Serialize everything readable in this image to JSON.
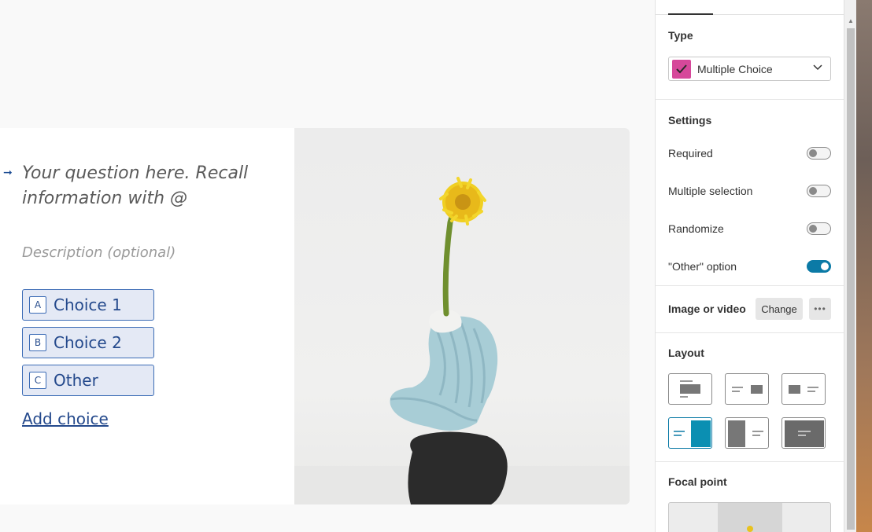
{
  "question": {
    "title": "Your question here. Recall information with @",
    "description": "Description (optional)",
    "choices": [
      {
        "key": "A",
        "label": "Choice 1"
      },
      {
        "key": "B",
        "label": "Choice 2"
      },
      {
        "key": "C",
        "label": "Other"
      }
    ],
    "add_choice": "Add choice"
  },
  "panel": {
    "type": {
      "heading": "Type",
      "value": "Multiple Choice",
      "color": "#d6489a"
    },
    "settings": {
      "heading": "Settings",
      "rows": [
        {
          "label": "Required",
          "on": false
        },
        {
          "label": "Multiple selection",
          "on": false
        },
        {
          "label": "Randomize",
          "on": false
        },
        {
          "label": "\"Other\" option",
          "on": true
        }
      ]
    },
    "media": {
      "heading": "Image or video",
      "change": "Change"
    },
    "layout": {
      "heading": "Layout",
      "selected_index": 3
    },
    "focal": {
      "heading": "Focal point"
    }
  },
  "colors": {
    "accent": "#0b7aa6",
    "choice_border": "#3b6bb5",
    "choice_text": "#24498c"
  }
}
